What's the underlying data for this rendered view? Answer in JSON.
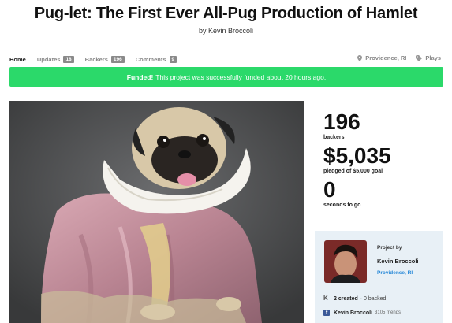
{
  "header": {
    "title": "Pug-let: The First Ever All-Pug Production of Hamlet",
    "byline": "by Kevin Broccoli"
  },
  "tabs": [
    {
      "label": "Home",
      "count": null,
      "active": true
    },
    {
      "label": "Updates",
      "count": "18",
      "active": false
    },
    {
      "label": "Backers",
      "count": "196",
      "active": false
    },
    {
      "label": "Comments",
      "count": "9",
      "active": false
    }
  ],
  "meta": {
    "location": "Providence, RI",
    "category": "Plays"
  },
  "funded_bar": {
    "strong": "Funded!",
    "text": "This project was successfully funded about 20 hours ago.",
    "color": "#2bd96a"
  },
  "stats": {
    "backers_value": "196",
    "backers_label": "backers",
    "pledged_value": "$5,035",
    "pledged_label": "pledged of $5,000 goal",
    "time_value": "0",
    "time_label": "seconds to go"
  },
  "creator": {
    "project_by": "Project by",
    "name": "Kevin Broccoli",
    "location": "Providence, RI",
    "created_count": "2 created",
    "backed_text": "· 0 backed",
    "fb_name": "Kevin Broccoli",
    "fb_friends": "3105 friends"
  },
  "icons": {
    "location": "map-pin-icon",
    "category": "tag-icon",
    "kickstarter": "kickstarter-k-icon",
    "facebook": "facebook-icon"
  }
}
